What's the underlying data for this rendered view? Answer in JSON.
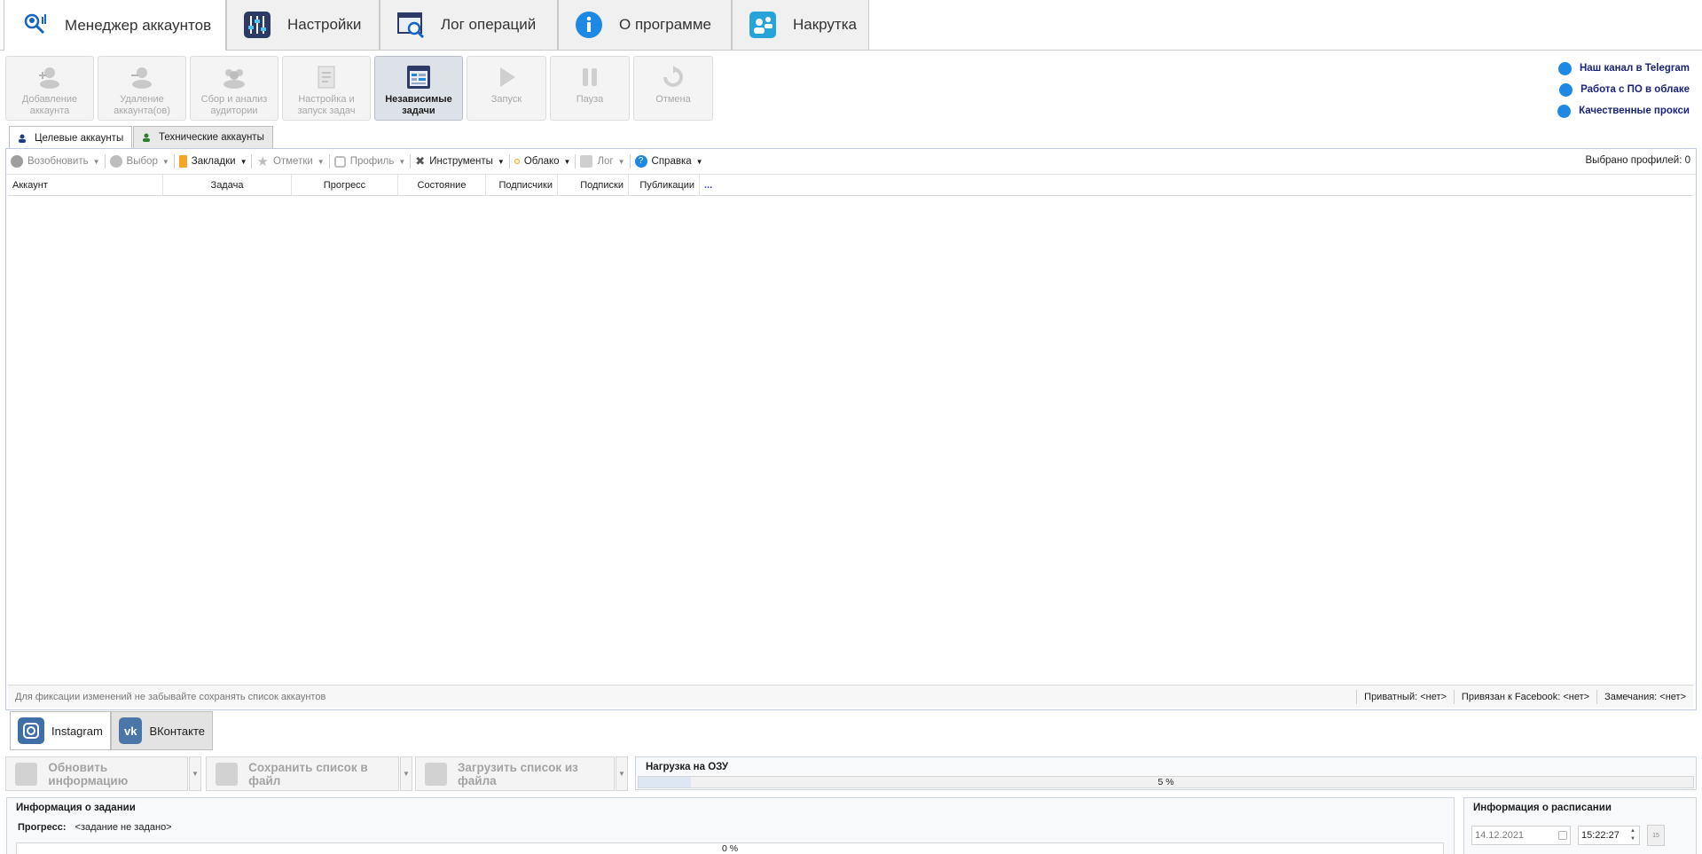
{
  "top_tabs": [
    {
      "label": "Менеджер аккаунтов",
      "icon": "account-search-icon"
    },
    {
      "label": "Настройки",
      "icon": "sliders-icon"
    },
    {
      "label": "Лог операций",
      "icon": "log-search-icon"
    },
    {
      "label": "О программе",
      "icon": "info-icon"
    },
    {
      "label": "Накрутка",
      "icon": "boost-people-icon"
    }
  ],
  "ribbon": [
    {
      "label": "Добавление\nаккаунта",
      "icon": "add-account-icon"
    },
    {
      "label": "Удаление\nаккаунта(ов)",
      "icon": "remove-account-icon"
    },
    {
      "label": "Сбор и анализ\nаудитории",
      "icon": "audience-icon"
    },
    {
      "label": "Настройка и\nзапуск задач",
      "icon": "task-setup-icon"
    },
    {
      "label": "Независимые\nзадачи",
      "icon": "independent-tasks-icon"
    },
    {
      "label": "Запуск",
      "icon": "play-icon"
    },
    {
      "label": "Пауза",
      "icon": "pause-icon"
    },
    {
      "label": "Отмена",
      "icon": "undo-icon"
    }
  ],
  "right_links": [
    {
      "label": "Наш канал в Telegram",
      "icon": "telegram-icon"
    },
    {
      "label": "Работа с ПО в облаке",
      "icon": "cloud-user-icon"
    },
    {
      "label": "Качественные прокси",
      "icon": "globe-icon"
    }
  ],
  "account_tabs": [
    {
      "label": "Целевые аккаунты"
    },
    {
      "label": "Технические аккаунты"
    }
  ],
  "toolbar": {
    "items": [
      {
        "label": "Возобновить",
        "icon": "resume-icon"
      },
      {
        "label": "Выбор",
        "icon": "check-icon"
      },
      {
        "label": "Закладки",
        "icon": "bookmark-icon"
      },
      {
        "label": "Отметки",
        "icon": "star-icon"
      },
      {
        "label": "Профиль",
        "icon": "instagram-profile-icon"
      },
      {
        "label": "Инструменты",
        "icon": "tools-icon"
      },
      {
        "label": "Облако",
        "icon": "cloud-icon"
      },
      {
        "label": "Лог",
        "icon": "log-icon"
      },
      {
        "label": "Справка",
        "icon": "help-icon"
      }
    ],
    "selected_count": "Выбрано профилей: 0"
  },
  "grid": {
    "columns": [
      "Аккаунт",
      "Задача",
      "Прогресс",
      "Состояние",
      "Подписчики",
      "Подписки",
      "Публикации",
      "..."
    ]
  },
  "status": {
    "hint": "Для фиксации изменений не забывайте сохранять список аккаунтов",
    "private": "Приватный:  <нет>",
    "facebook": "Привязан к Facebook:  <нет>",
    "remarks": "Замечания:  <нет>"
  },
  "network_tabs": [
    {
      "label": "Instagram",
      "icon": "instagram-icon"
    },
    {
      "label": "ВКонтакте",
      "icon": "vk-icon"
    }
  ],
  "bottom_buttons": {
    "refresh": "Обновить информацию",
    "save": "Сохранить список в файл",
    "load": "Загрузить список из файла"
  },
  "ram": {
    "title": "Нагрузка на ОЗУ",
    "value_text": "5 %",
    "value": 5
  },
  "task_info": {
    "title": "Информация о задании",
    "progress_label": "Прогресс:",
    "progress_value": "<задание не задано>",
    "bar_text": "0 %",
    "bar_value": 0
  },
  "schedule": {
    "title": "Информация о расписании",
    "date": "14.12.2021",
    "time": "15:22:27",
    "calendar_icon_text": "15"
  },
  "colors": {
    "accent": "#1e88e5",
    "link": "#1a237e",
    "vk": "#4a76a8",
    "instagram": "#3f6fa5"
  }
}
